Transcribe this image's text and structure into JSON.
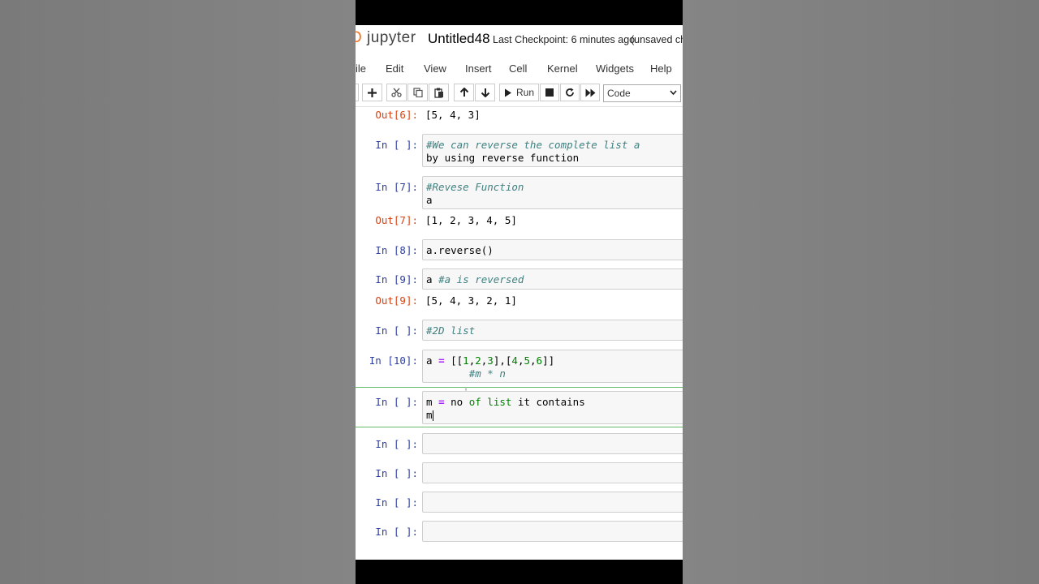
{
  "header": {
    "logo_prefix": "Ɔ",
    "logo": "jupyter",
    "notebook_name": "Untitled48",
    "checkpoint": "Last Checkpoint: 6 minutes ago",
    "unsaved": "(unsaved cha"
  },
  "menu": [
    "ile",
    "Edit",
    "View",
    "Insert",
    "Cell",
    "Kernel",
    "Widgets",
    "Help"
  ],
  "toolbar": {
    "run_label": "Run",
    "cell_type": "Code"
  },
  "cells": {
    "out6_prompt": "Out[6]:",
    "out6_value": "[5, 4, 3]",
    "c1_prompt": "In [ ]:",
    "c1_line1": "#We can reverse the complete list a",
    "c1_line2": "by using reverse function",
    "c2_prompt": "In [7]:",
    "c2_line1": "#Revese Function",
    "c2_line2": "a",
    "out7_prompt": "Out[7]:",
    "out7_value": "[1, 2, 3, 4, 5]",
    "c3_prompt": "In [8]:",
    "c3_line1": "a.reverse()",
    "c4_prompt": "In [9]:",
    "c4_code": "a ",
    "c4_comment": "#a is reversed",
    "out9_prompt": "Out[9]:",
    "out9_value": "[5, 4, 3, 2, 1]",
    "c5_prompt": "In [ ]:",
    "c5_line1": "#2D list",
    "c6_prompt": "In [10]:",
    "c6_a": "a ",
    "c6_eq": "=",
    "c6_open": " [[",
    "c6_n1": "1",
    "c6_n2": "2",
    "c6_n3": "3",
    "c6_n4": "4",
    "c6_n5": "5",
    "c6_n6": "6",
    "c6_line2": "#m * n",
    "c7_prompt": "In [ ]:",
    "c7_m": "m ",
    "c7_eq": "=",
    "c7_no": " no ",
    "c7_of": "of",
    "c7_list": "list",
    "c7_rest": " it contains",
    "c7_line2": "m",
    "empty_prompt": "In [ ]:"
  }
}
